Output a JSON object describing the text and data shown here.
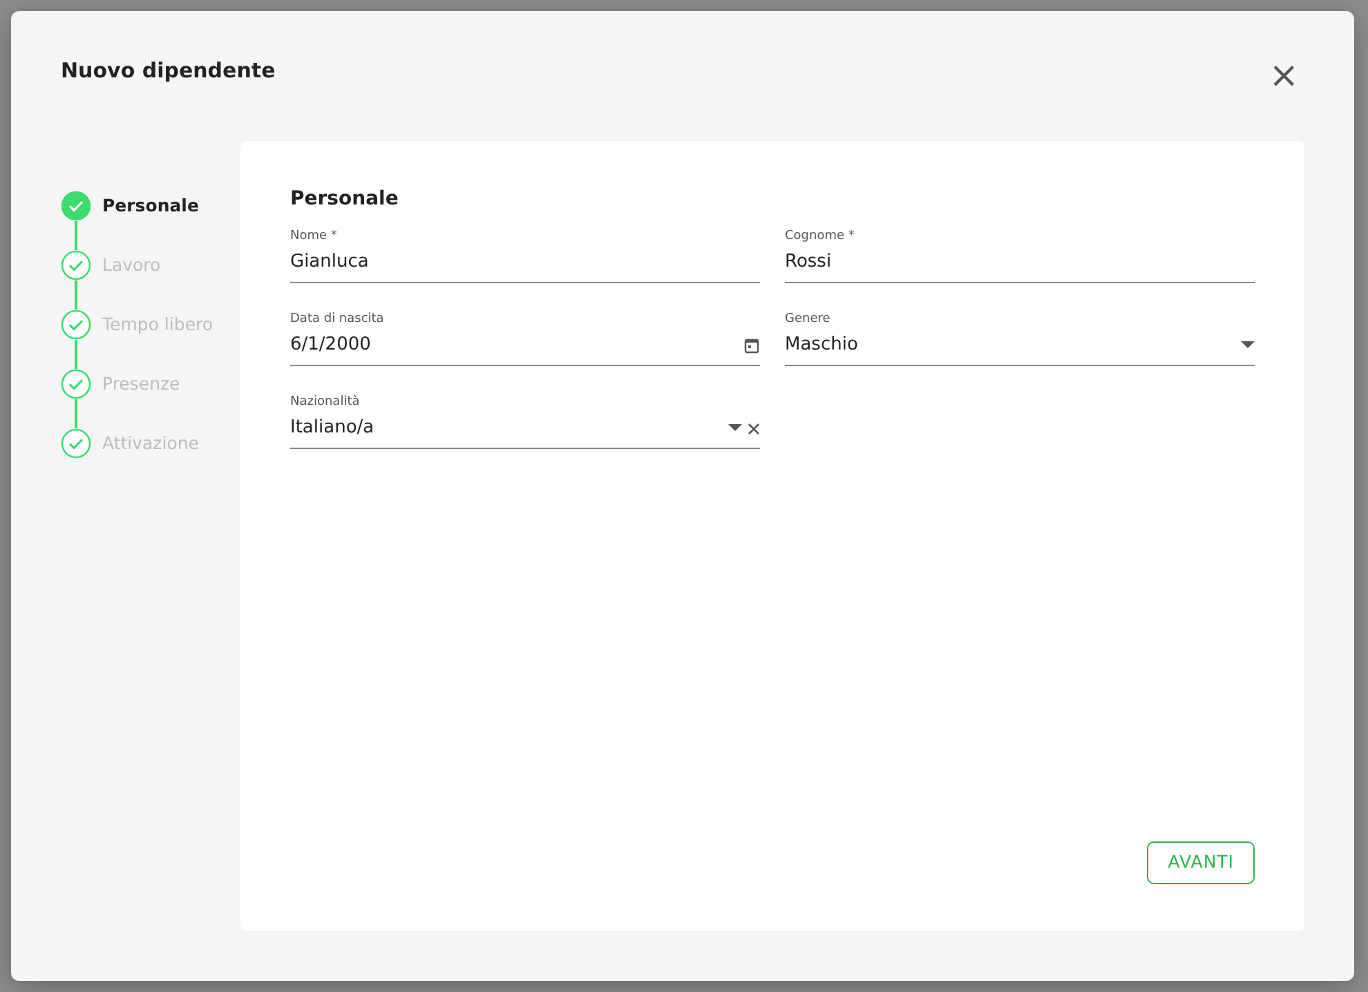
{
  "dialog": {
    "title": "Nuovo dipendente",
    "close": "×"
  },
  "steps": [
    {
      "label": "Personale",
      "selected": true
    },
    {
      "label": "Lavoro",
      "selected": false
    },
    {
      "label": "Tempo libero",
      "selected": false
    },
    {
      "label": "Presenze",
      "selected": false
    },
    {
      "label": "Attivazione",
      "selected": false
    }
  ],
  "section_title": "Personale",
  "fields": [
    {
      "kind": "text",
      "label": "Nome *",
      "value": "Gianluca"
    },
    {
      "kind": "text",
      "label": "Cognome *",
      "value": "Rossi"
    },
    {
      "kind": "date",
      "label": "Data di nascita",
      "value": "6/1/2000"
    },
    {
      "kind": "select",
      "label": "Genere",
      "value": "Maschio"
    },
    {
      "kind": "autocomplete",
      "label": "Nazionalità",
      "value": "Italiano/a"
    }
  ],
  "next_button": "AVANTI"
}
